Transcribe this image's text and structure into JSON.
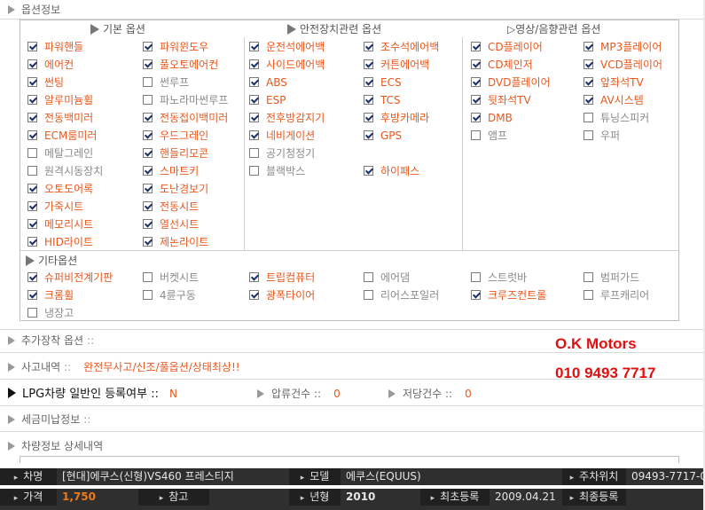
{
  "section_option_info": "옵션정보",
  "columns": {
    "basic": "기본 옵션",
    "safety": "안전장치관련 옵션",
    "av": "▷영상/음향관련 옵션"
  },
  "options_basic_a": [
    {
      "label": "파워핸들",
      "checked": true
    },
    {
      "label": "에어컨",
      "checked": true
    },
    {
      "label": "썬팅",
      "checked": true
    },
    {
      "label": "알루미늄휠",
      "checked": true
    },
    {
      "label": "전동백미러",
      "checked": true
    },
    {
      "label": "ECM룸미러",
      "checked": true
    },
    {
      "label": "메탈그레인",
      "checked": false
    },
    {
      "label": "원격시동장치",
      "checked": false
    },
    {
      "label": "오토도어록",
      "checked": true
    },
    {
      "label": "가죽시트",
      "checked": true
    },
    {
      "label": "메모리시트",
      "checked": true
    },
    {
      "label": "HID라이트",
      "checked": true
    }
  ],
  "options_basic_b": [
    {
      "label": "파워윈도우",
      "checked": true
    },
    {
      "label": "풀오토에어컨",
      "checked": true
    },
    {
      "label": "썬루프",
      "checked": false
    },
    {
      "label": "파노라마썬루프",
      "checked": false
    },
    {
      "label": "전동접이백미러",
      "checked": true
    },
    {
      "label": "우드그레인",
      "checked": true
    },
    {
      "label": "핸들리모콘",
      "checked": true
    },
    {
      "label": "스마트키",
      "checked": true
    },
    {
      "label": "도난경보기",
      "checked": true
    },
    {
      "label": "전동시트",
      "checked": true
    },
    {
      "label": "열선시트",
      "checked": true
    },
    {
      "label": "제논라이트",
      "checked": true
    }
  ],
  "options_safety_a": [
    {
      "label": "운전석에어백",
      "checked": true
    },
    {
      "label": "사이드에어백",
      "checked": true
    },
    {
      "label": "ABS",
      "checked": true
    },
    {
      "label": "ESP",
      "checked": true
    },
    {
      "label": "전후방감지기",
      "checked": true
    },
    {
      "label": "네비게이션",
      "checked": true
    },
    {
      "label": "공기청정기",
      "checked": false
    },
    {
      "label": "블랙박스",
      "checked": false
    }
  ],
  "options_safety_b": [
    {
      "label": "조수석에어백",
      "checked": true
    },
    {
      "label": "커튼에어백",
      "checked": true
    },
    {
      "label": "ECS",
      "checked": true
    },
    {
      "label": "TCS",
      "checked": true
    },
    {
      "label": "후방카메라",
      "checked": true
    },
    {
      "label": "GPS",
      "checked": true
    },
    {
      "label": "",
      "checked": null
    },
    {
      "label": "하이패스",
      "checked": true
    }
  ],
  "options_av_a": [
    {
      "label": "CD플레이어",
      "checked": true
    },
    {
      "label": "CD체인저",
      "checked": true
    },
    {
      "label": "DVD플레이어",
      "checked": true
    },
    {
      "label": "뒷좌석TV",
      "checked": true
    },
    {
      "label": "DMB",
      "checked": true
    },
    {
      "label": "앰프",
      "checked": false
    }
  ],
  "options_av_b": [
    {
      "label": "MP3플레이어",
      "checked": true
    },
    {
      "label": "VCD플레이어",
      "checked": true
    },
    {
      "label": "앞좌석TV",
      "checked": true
    },
    {
      "label": "AV시스템",
      "checked": true
    },
    {
      "label": "튜닝스피커",
      "checked": false
    },
    {
      "label": "우퍼",
      "checked": false
    }
  ],
  "etc_title": "기타옵션",
  "options_etc": [
    {
      "label": "슈퍼비전계기판",
      "checked": true
    },
    {
      "label": "버켓시트",
      "checked": false
    },
    {
      "label": "트립컴퓨터",
      "checked": true
    },
    {
      "label": "에어댐",
      "checked": false
    },
    {
      "label": "스트럿바",
      "checked": false
    },
    {
      "label": "범퍼가드",
      "checked": false
    },
    {
      "label": "크롬휠",
      "checked": true
    },
    {
      "label": "4륜구동",
      "checked": false
    },
    {
      "label": "광폭타이어",
      "checked": true
    },
    {
      "label": "리어스포일러",
      "checked": false
    },
    {
      "label": "크루즈컨트롤",
      "checked": true
    },
    {
      "label": "루프캐리어",
      "checked": false
    },
    {
      "label": "냉장고",
      "checked": false
    }
  ],
  "extra_options": {
    "label": "추가장착 옵션",
    "sep": "::"
  },
  "accident": {
    "label": "사고내역",
    "sep": "::",
    "value": "완전무사고/신조/풀옵션/상태최상!!"
  },
  "dealer": {
    "name": "O.K Motors",
    "phone": "010 9493 7717"
  },
  "lpg": {
    "label": "LPG차량 일반인 등록여부 ::",
    "value": "N",
    "seizure_label": "압류건수 ::",
    "seizure_value": "0",
    "mortgage_label": "저당건수 ::",
    "mortgage_value": "0"
  },
  "unpaid_tax": {
    "label": "세금미납정보",
    "sep": "::"
  },
  "vehicle_detail": {
    "label": "차량정보 상세내역"
  },
  "info_bar": {
    "row1": [
      {
        "label": "차명",
        "value": "[현대]에쿠스(신형)VS460 프레스티지"
      },
      {
        "label": "모델",
        "value": "에쿠스(EQUUS)"
      },
      {
        "label": "주차위치",
        "value": "09493-7717-01"
      }
    ],
    "row2": [
      {
        "label": "가격",
        "value": "1,750"
      },
      {
        "label": "참고",
        "value": ""
      },
      {
        "label": "년형",
        "value": "2010"
      },
      {
        "label": "최초등록",
        "value": "2009.04.21"
      },
      {
        "label": "최종등록",
        "value": ""
      }
    ]
  }
}
